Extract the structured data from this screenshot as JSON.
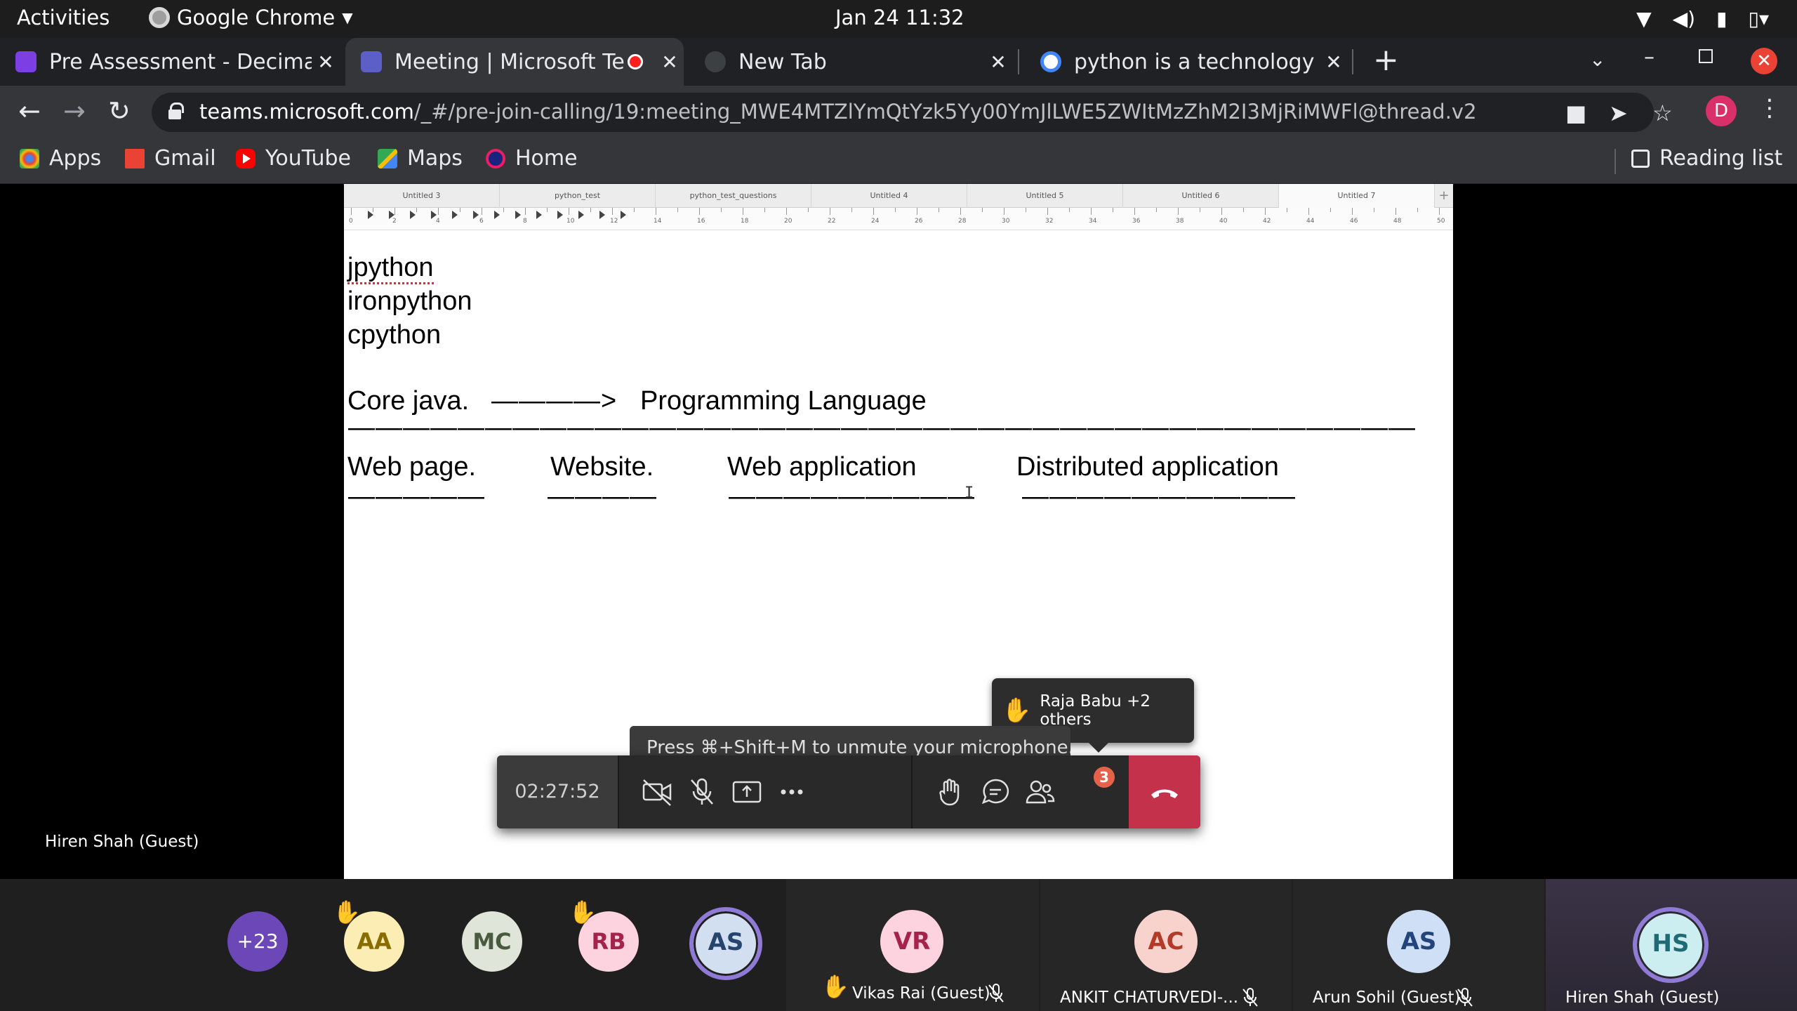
{
  "os": {
    "activities": "Activities",
    "app_name": "Google Chrome",
    "clock": "Jan 24  11:32"
  },
  "tabs": [
    {
      "title": "Pre Assessment - Decimal",
      "icon": "forms-icon",
      "color": "#7b3fe4"
    },
    {
      "title": "Meeting | Microsoft Te",
      "icon": "teams-icon",
      "color": "#5b5fc7",
      "recording": true
    },
    {
      "title": "New Tab",
      "icon": "chrome-icon",
      "color": "#5f6368"
    },
    {
      "title": "python is a technology or",
      "icon": "google-icon",
      "color": "#4285f4"
    }
  ],
  "address": {
    "host": "teams.microsoft.com",
    "path": "/_#/pre-join-calling/19:meeting_MWE4MTZlYmQtYzk5Yy00YmJlLWE5ZWItMzZhM2I3MjRiMWFl@thread.v2",
    "profile_initial": "D"
  },
  "bookmarks": {
    "apps": "Apps",
    "gmail": "Gmail",
    "youtube": "YouTube",
    "maps": "Maps",
    "home": "Home",
    "reading_list": "Reading list"
  },
  "document": {
    "sheet_tabs": [
      "Untitled 3",
      "python_test",
      "python_test_questions",
      "Untitled 4",
      "Untitled 5",
      "Untitled 6",
      "Untitled 7"
    ],
    "lines": [
      "jpython",
      "ironpython",
      "cpython"
    ],
    "core_java": "Core java.",
    "arrow": "————>",
    "programming_language": "Programming Language",
    "long_dash": "———————————————————————————————————————",
    "columns": [
      "Web page.",
      "Website.",
      "Web application",
      "Distributed application"
    ],
    "col_dashes": [
      "—————",
      "————",
      "—————————",
      "——————————"
    ]
  },
  "raised_hands": {
    "text": "Raja Babu +2 others"
  },
  "mute_tooltip": "Press ⌘+Shift+M to unmute your microphone.",
  "call": {
    "timer": "02:27:52",
    "participants_badge": "3"
  },
  "presenter": "Hiren Shah (Guest)",
  "gallery": {
    "overflow": "+23",
    "small": [
      {
        "initials": "AA",
        "bg": "#fbedb3",
        "fg": "#8a6b00",
        "hand": true
      },
      {
        "initials": "MC",
        "bg": "#dfe6d9",
        "fg": "#4a5a3e",
        "hand": false
      },
      {
        "initials": "RB",
        "bg": "#fcd3de",
        "fg": "#a5234b",
        "hand": true
      },
      {
        "initials": "AS",
        "bg": "#d2dff0",
        "fg": "#26446e",
        "hand": false
      }
    ],
    "tiles": [
      {
        "initials": "VR",
        "name": "Vikas Rai (Guest)",
        "bg": "#fcd3de",
        "fg": "#a5234b"
      },
      {
        "initials": "AC",
        "name": "ANKIT CHATURVEDI-...",
        "bg": "#f8d3cd",
        "fg": "#b33a29"
      },
      {
        "initials": "AS",
        "name": "Arun Sohil (Guest)",
        "bg": "#cfdff5",
        "fg": "#24457c"
      },
      {
        "initials": "HS",
        "name": "Hiren Shah (Guest)",
        "bg": "#cdeef0",
        "fg": "#1f6a74"
      }
    ]
  }
}
